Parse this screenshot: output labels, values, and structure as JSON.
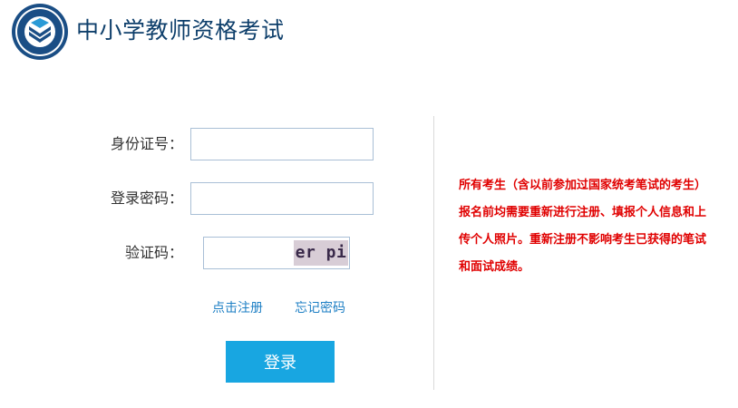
{
  "header": {
    "title": "中小学教师资格考试",
    "logo_icon": "badge-logo-icon"
  },
  "form": {
    "id_label": "身份证号：",
    "id_value": "",
    "password_label": "登录密码：",
    "password_value": "",
    "captcha_label": "验证码：",
    "captcha_value": "",
    "captcha_image_text": "er pi"
  },
  "links": {
    "register": "点击注册",
    "forgot_password": "忘记密码"
  },
  "login_button": "登录",
  "notice": "所有考生（含以前参加过国家统考笔试的考生）报名前均需要重新进行注册、填报个人信息和上传个人照片。重新注册不影响考生已获得的笔试和面试成绩。",
  "colors": {
    "title": "#0e3f6b",
    "button": "#18a6e1",
    "link": "#1d7fc4",
    "notice": "#e00000"
  }
}
